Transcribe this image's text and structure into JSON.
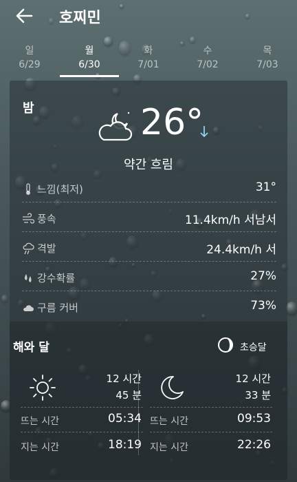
{
  "header": {
    "city": "호찌민"
  },
  "days": [
    {
      "weekday": "일",
      "date": "6/29"
    },
    {
      "weekday": "월",
      "date": "6/30"
    },
    {
      "weekday": "화",
      "date": "7/01"
    },
    {
      "weekday": "수",
      "date": "7/02"
    },
    {
      "weekday": "목",
      "date": "7/03"
    }
  ],
  "selected_day": "월",
  "current": {
    "period": "밤",
    "temperature": "26°",
    "condition": "약간 흐림",
    "details": [
      {
        "icon": "thermometer-icon",
        "label": "느낌(최저)",
        "value": "31°"
      },
      {
        "icon": "wind-icon",
        "label": "풍속",
        "value": "11.4km/h 서남서"
      },
      {
        "icon": "gust-icon",
        "label": "격발",
        "value": "24.4km/h 서"
      },
      {
        "icon": "rain-drops-icon",
        "label": "강수확률",
        "value": "27%"
      },
      {
        "icon": "cloud-icon",
        "label": "구름 커버",
        "value": "73%"
      }
    ]
  },
  "sun_moon": {
    "title": "해와 달",
    "moon_phase": "초승달",
    "sun": {
      "duration_hours": "12 시간",
      "duration_minutes": "45 분",
      "rise_label": "뜨는 시간",
      "rise": "05:34",
      "set_label": "지는 시간",
      "set": "18:19"
    },
    "moon": {
      "duration_hours": "12 시간",
      "duration_minutes": "33 분",
      "rise_label": "뜨는 시간",
      "rise": "09:53",
      "set_label": "지는 시간",
      "set": "22:26"
    }
  }
}
